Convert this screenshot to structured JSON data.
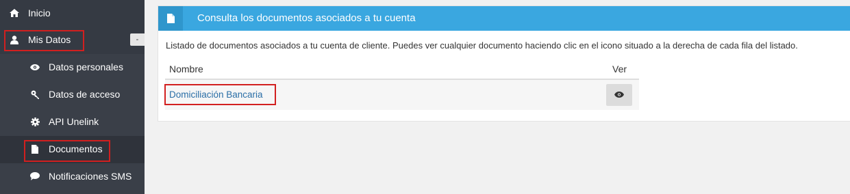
{
  "sidebar": {
    "items": [
      {
        "label": "Inicio",
        "icon": "home-icon"
      },
      {
        "label": "Mis Datos",
        "icon": "user-icon"
      },
      {
        "label": "Datos personales",
        "icon": "eye-icon"
      },
      {
        "label": "Datos de acceso",
        "icon": "key-icon"
      },
      {
        "label": "API Unelink",
        "icon": "gear-icon"
      },
      {
        "label": "Documentos",
        "icon": "document-icon"
      },
      {
        "label": "Notificaciones SMS",
        "icon": "comment-icon"
      }
    ],
    "collapse_label": "-"
  },
  "panel": {
    "title": "Consulta los documentos asociados a tu cuenta",
    "description": "Listado de documentos asociados a tu cuenta de cliente. Puedes ver cualquier documento haciendo clic en el icono situado a la derecha de cada fila del listado.",
    "columns": [
      "Nombre",
      "Ver"
    ],
    "rows": [
      {
        "name": "Domiciliación Bancaria"
      }
    ]
  },
  "colors": {
    "sidebar": "#3a3f48",
    "header": "#3aa7e0",
    "highlight": "#d21f1f",
    "link": "#2a6ea6"
  }
}
